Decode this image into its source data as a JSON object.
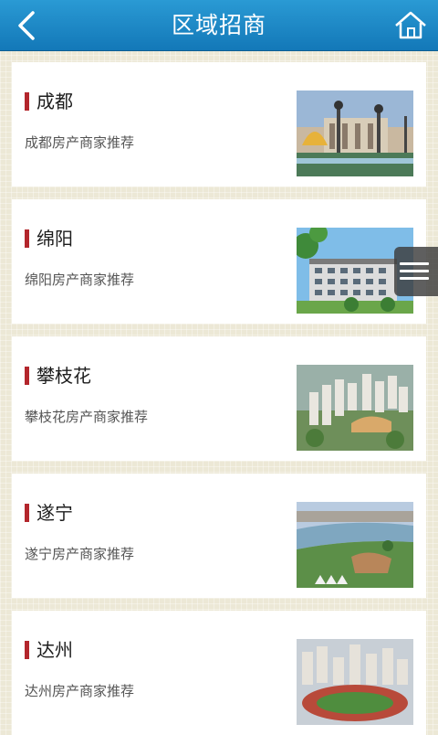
{
  "header": {
    "title": "区域招商",
    "back_icon": "back-arrow-icon",
    "home_icon": "home-icon"
  },
  "cards": [
    {
      "name": "成都",
      "desc": "成都房产商家推荐"
    },
    {
      "name": "绵阳",
      "desc": "绵阳房产商家推荐"
    },
    {
      "name": "攀枝花",
      "desc": "攀枝花房产商家推荐"
    },
    {
      "name": "遂宁",
      "desc": "遂宁房产商家推荐"
    },
    {
      "name": "达州",
      "desc": "达州房产商家推荐"
    }
  ],
  "floating_menu_icon": "menu-icon",
  "colors": {
    "header": "#1b88c7",
    "accent_marker": "#b3262c",
    "background": "#ece8d6"
  }
}
